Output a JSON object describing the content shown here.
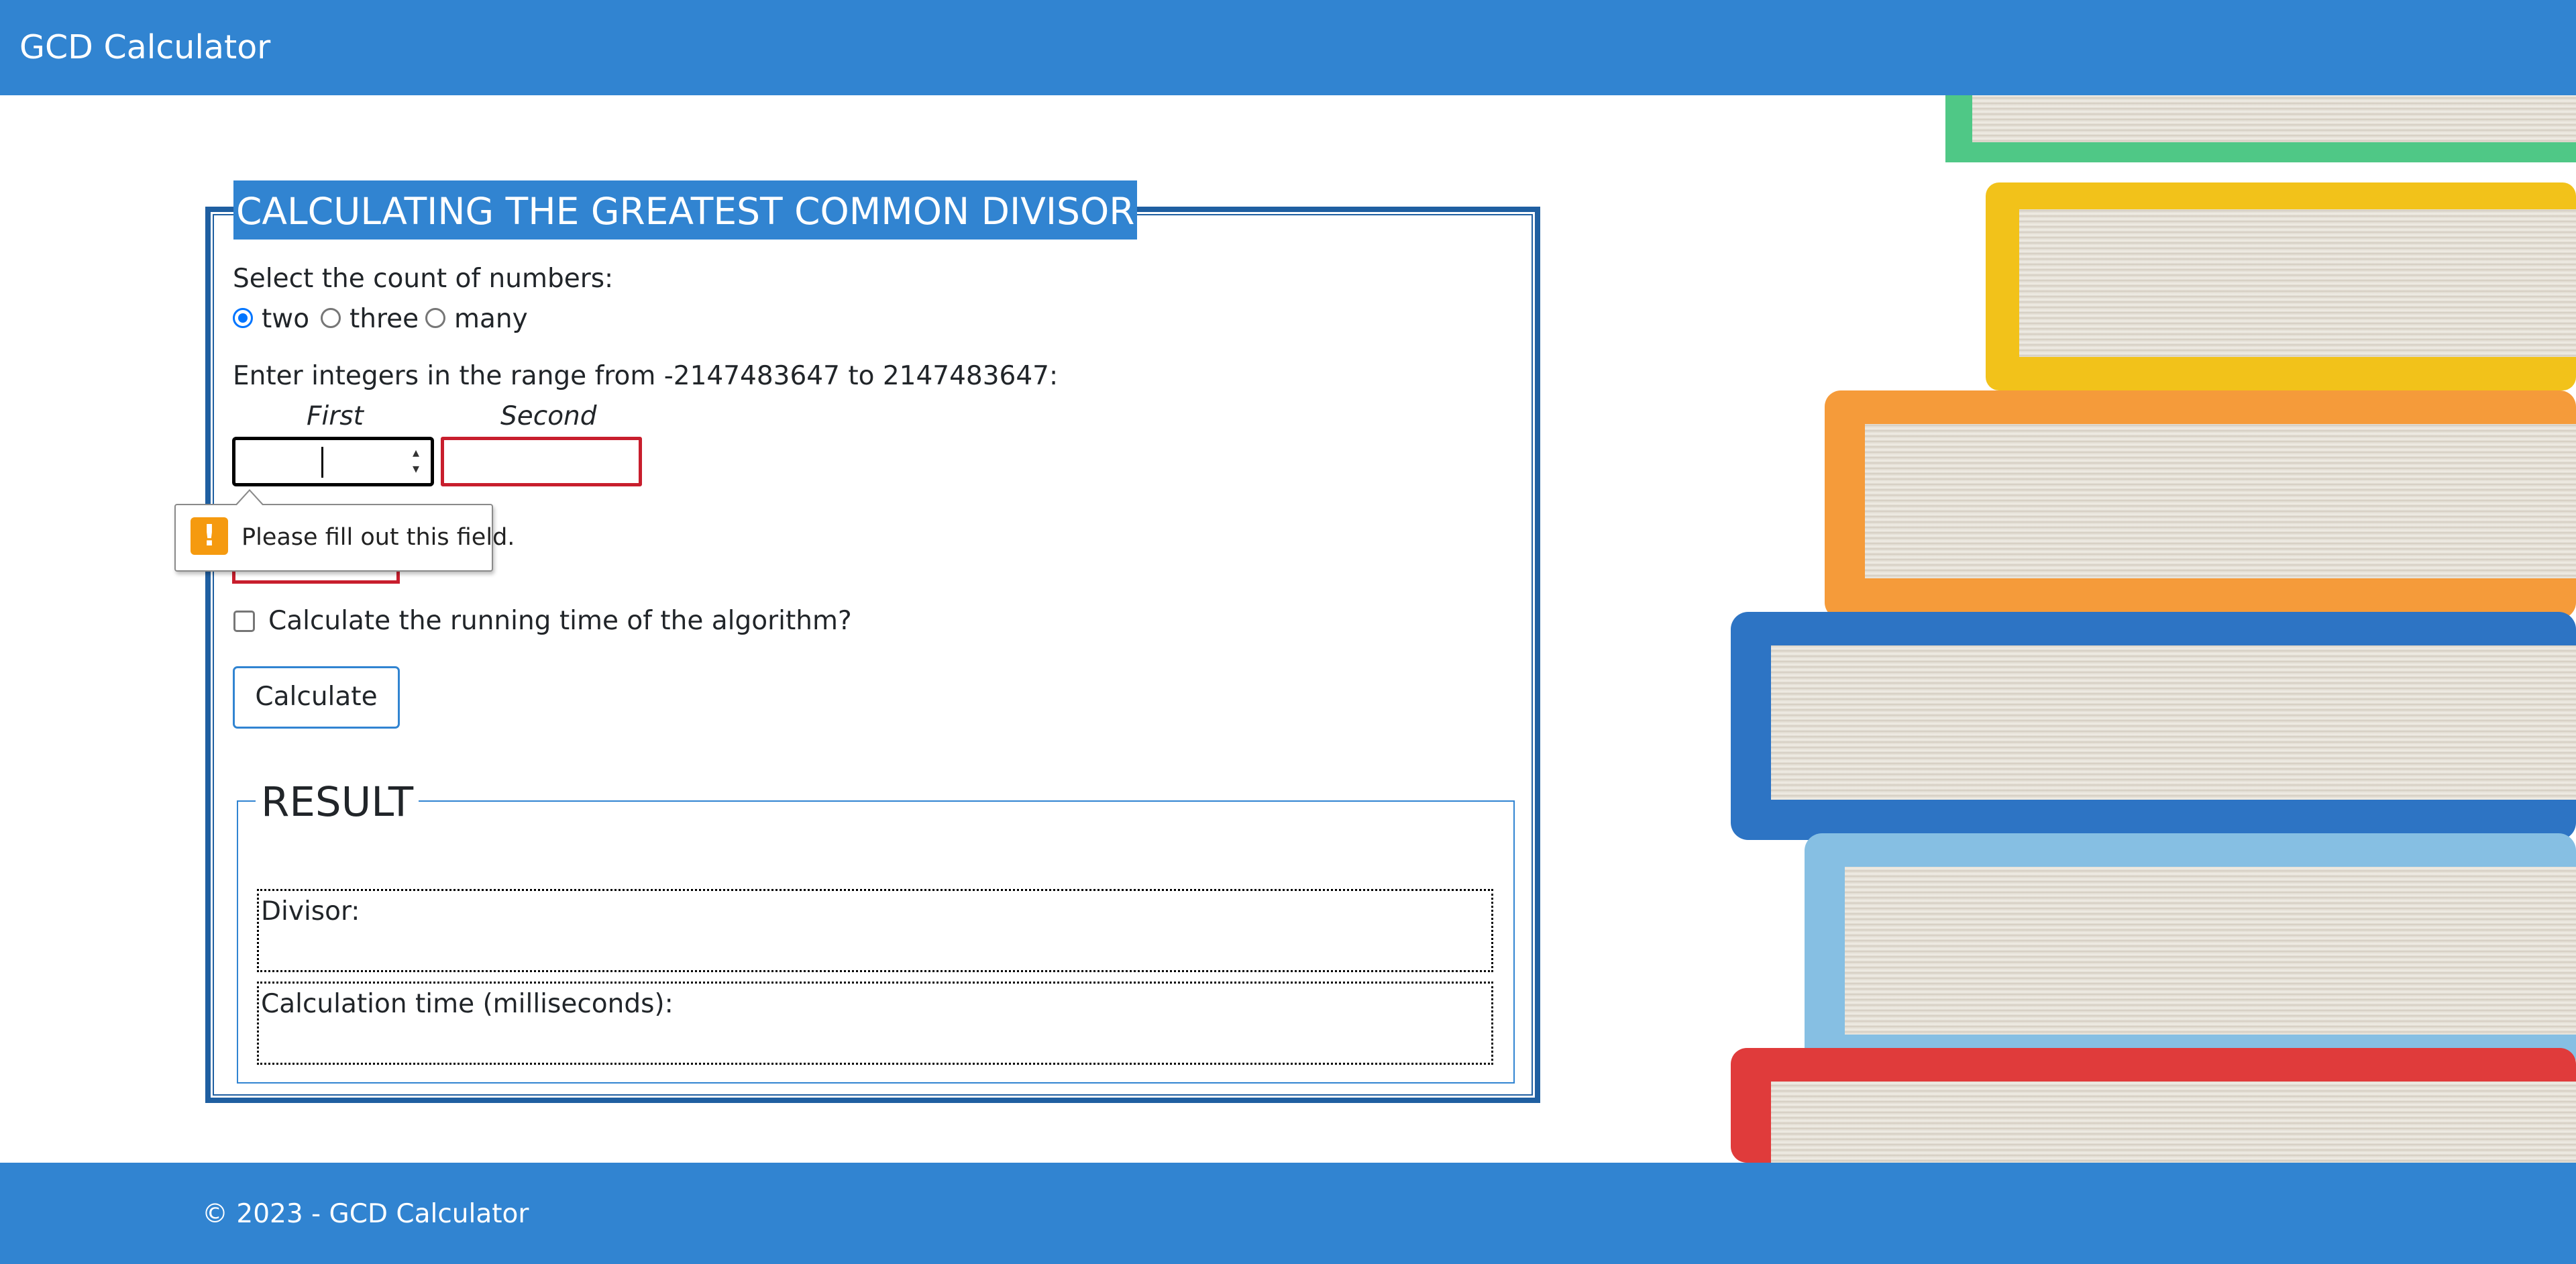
{
  "header": {
    "brand": "GCD Calculator"
  },
  "form": {
    "title": "CALCULATING THE GREATEST COMMON DIVISOR",
    "count_prompt": "Select the count of numbers:",
    "count_options": [
      {
        "label": "two",
        "checked": true
      },
      {
        "label": "three",
        "checked": false
      },
      {
        "label": "many",
        "checked": false
      }
    ],
    "range_prompt": "Enter integers in the range from -2147483647 to 2147483647:",
    "columns": {
      "first": "First",
      "second": "Second"
    },
    "inputs": {
      "first_value": "",
      "second_value": ""
    },
    "validation_tooltip": "Please fill out this field.",
    "runtime_checkbox_label": "Calculate the running time of the algorithm?",
    "runtime_checked": false,
    "calculate_label": "Calculate"
  },
  "result": {
    "legend": "RESULT",
    "divisor_label": "Divisor:",
    "time_label": "Calculation time (milliseconds):"
  },
  "footer": {
    "text": "© 2023 - GCD Calculator"
  },
  "colors": {
    "header_blue": "#3184d1",
    "panel_border": "#1f5fa1",
    "error_red": "#c81e2d",
    "warning_orange": "#f59a0f"
  }
}
